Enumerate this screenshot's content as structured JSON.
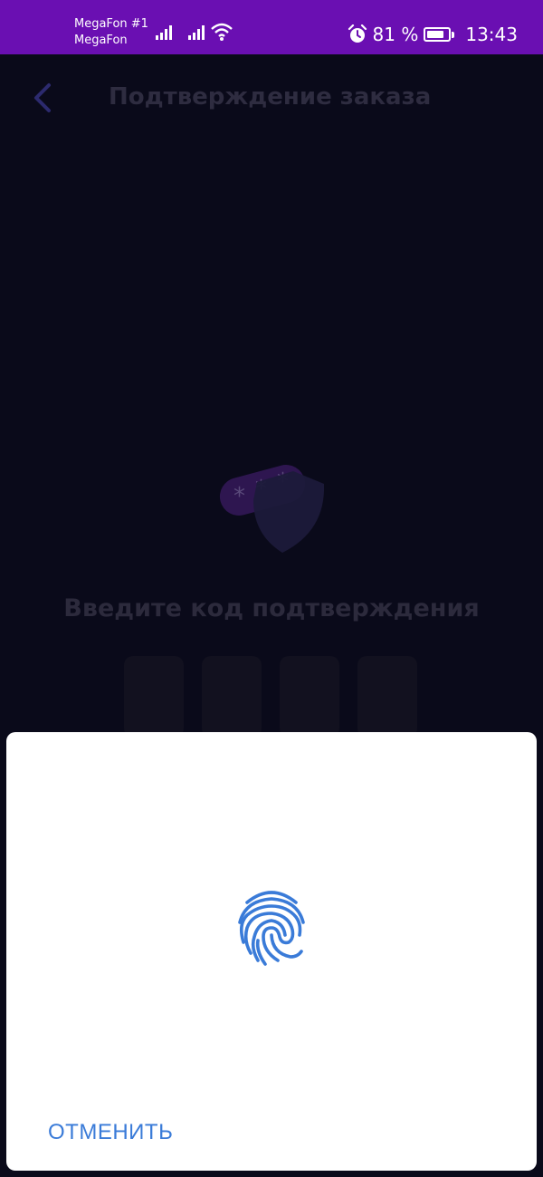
{
  "status_bar": {
    "carrier_primary": "MegaFon #1",
    "carrier_secondary": "MegaFon",
    "battery_percent": "81 %",
    "battery_level": 0.81,
    "time": "13:43",
    "icons": [
      "signal-icon",
      "signal-icon",
      "wifi-icon",
      "alarm-icon",
      "battery-icon"
    ]
  },
  "header": {
    "title": "Подтверждение заказа",
    "back_icon": "chevron-left-icon"
  },
  "main": {
    "illustration": "password-shield-icon",
    "code_prompt": "Введите код подтверждения",
    "code_boxes": [
      "",
      "",
      "",
      ""
    ]
  },
  "biometric_sheet": {
    "icon": "fingerprint-icon",
    "cancel_label": "ОТМЕНИТЬ"
  },
  "colors": {
    "status_bar_bg": "#6a0fb2",
    "background": "#0a0a1a",
    "accent": "#3a7bd8"
  }
}
